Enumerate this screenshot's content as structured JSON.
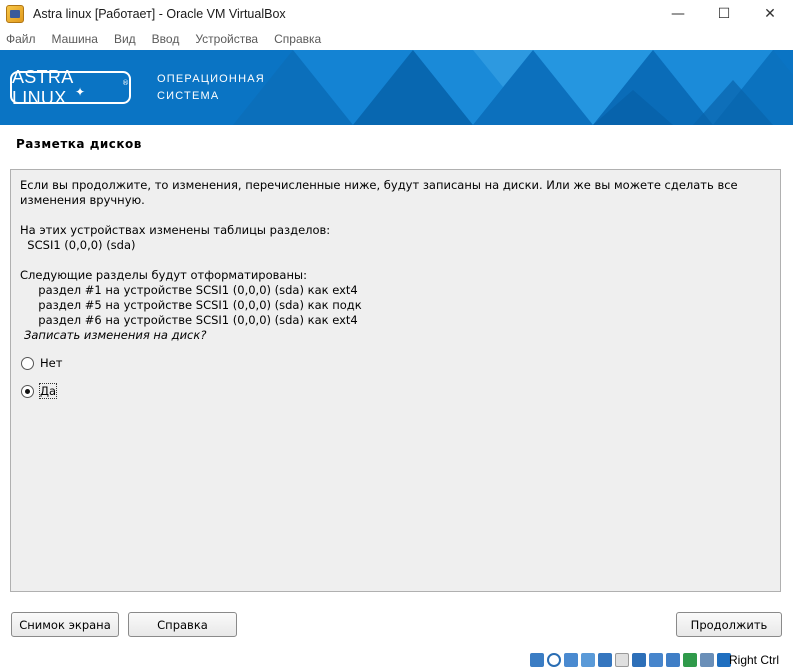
{
  "window": {
    "title": "Astra linux [Работает] - Oracle VM VirtualBox",
    "controls": {
      "minimize": "—",
      "maximize": "☐",
      "close": "✕"
    }
  },
  "menu": [
    "Файл",
    "Машина",
    "Вид",
    "Ввод",
    "Устройства",
    "Справка"
  ],
  "banner": {
    "logo": "ASTRA LINUX",
    "logo_mark": "®",
    "subtitle_line1": "ОПЕРАЦИОННАЯ",
    "subtitle_line2": "СИСТЕМА",
    "color": "#0a74c4"
  },
  "page": {
    "title": "Разметка дисков",
    "intro_line1": "Если вы продолжите, то изменения, перечисленные ниже, будут записаны на диски. Или же вы можете сделать все",
    "intro_line2": "изменения вручную.",
    "tables_header": "На этих устройствах изменены таблицы разделов:",
    "tables_device": "  SCSI1 (0,0,0) (sda)",
    "format_header": "Следующие разделы будут отформатированы:",
    "partitions": [
      "     раздел #1 на устройстве SCSI1 (0,0,0) (sda) как ext4",
      "     раздел #5 на устройстве SCSI1 (0,0,0) (sda) как подк",
      "     раздел #6 на устройстве SCSI1 (0,0,0) (sda) как ext4"
    ],
    "question": "Записать изменения на диск?",
    "options": [
      {
        "label": "Нет",
        "selected": false
      },
      {
        "label": "Да",
        "selected": true
      }
    ]
  },
  "buttons": {
    "screenshot": "Снимок экрана",
    "help": "Справка",
    "continue": "Продолжить"
  },
  "statusbar": {
    "host_key": "Right Ctrl",
    "icons": [
      "hard-disk-icon",
      "optical-drive-icon",
      "audio-icon",
      "network-icon",
      "usb-icon",
      "shared-folders-icon",
      "display-icon",
      "screen-capture-icon",
      "mouse-integration-icon",
      "virtualization-icon",
      "cpu-icon",
      "arrow-down-icon"
    ]
  }
}
